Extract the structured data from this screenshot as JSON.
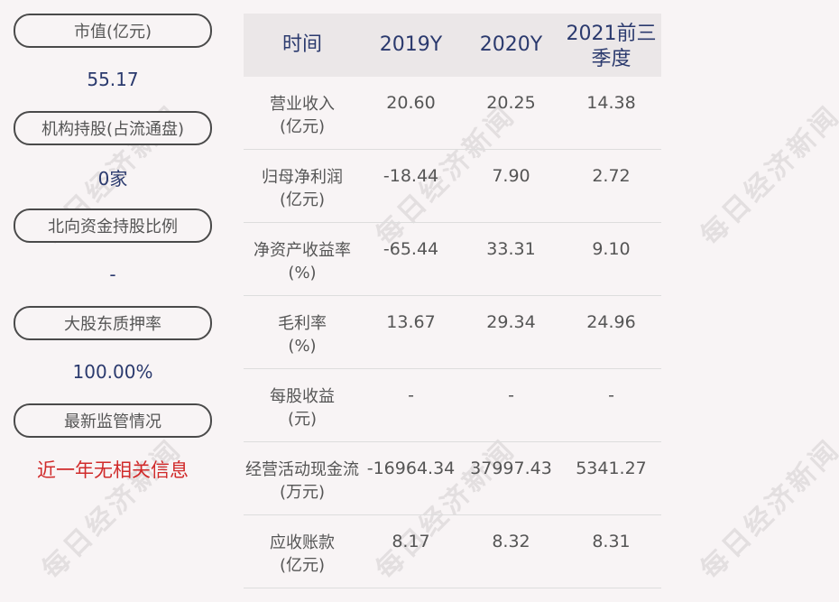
{
  "left_panel": [
    {
      "label": "市值(亿元)",
      "value": "55.17",
      "color": "#2b3a6e"
    },
    {
      "label": "机构持股(占流通盘)",
      "value": "0家",
      "color": "#2b3a6e"
    },
    {
      "label": "北向资金持股比例",
      "value": "-",
      "color": "#2b3a6e"
    },
    {
      "label": "大股东质押率",
      "value": "100.00%",
      "color": "#2b3a6e"
    },
    {
      "label": "最新监管情况",
      "value": "近一年无相关信息",
      "color": "#d02a2a"
    }
  ],
  "table": {
    "headers": [
      "时间",
      "2019Y",
      "2020Y",
      "2021前三季度"
    ],
    "rows": [
      {
        "label1": "营业收入",
        "label2": "(亿元)",
        "values": [
          "20.60",
          "20.25",
          "14.38"
        ]
      },
      {
        "label1": "归母净利润",
        "label2": "(亿元)",
        "values": [
          "-18.44",
          "7.90",
          "2.72"
        ]
      },
      {
        "label1": "净资产收益率",
        "label2": "(%)",
        "values": [
          "-65.44",
          "33.31",
          "9.10"
        ]
      },
      {
        "label1": "毛利率",
        "label2": "(%)",
        "values": [
          "13.67",
          "29.34",
          "24.96"
        ]
      },
      {
        "label1": "每股收益",
        "label2": "(元)",
        "values": [
          "-",
          "-",
          "-"
        ]
      },
      {
        "label1": "经营活动现金流",
        "label2": "(万元)",
        "values": [
          "-16964.34",
          "37997.43",
          "5341.27"
        ]
      },
      {
        "label1": "应收账款",
        "label2": "(亿元)",
        "values": [
          "8.17",
          "8.32",
          "8.31"
        ]
      }
    ]
  },
  "watermark": "每日经济新闻"
}
